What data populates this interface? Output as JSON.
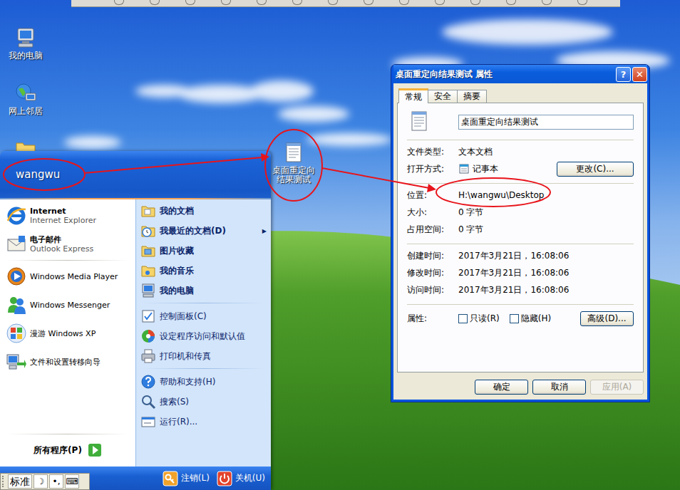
{
  "desktop": {
    "icons": [
      {
        "label": "我的电脑"
      },
      {
        "label": "网上邻居"
      }
    ],
    "file": {
      "label": "桌面重定向结果测试"
    }
  },
  "start_menu": {
    "user": "wangwu",
    "pinned": [
      {
        "title": "Internet",
        "subtitle": "Internet Explorer"
      },
      {
        "title": "电子邮件",
        "subtitle": "Outlook Express"
      }
    ],
    "recent": [
      {
        "label": "Windows Media Player"
      },
      {
        "label": "Windows Messenger"
      },
      {
        "label": "漫游 Windows XP"
      },
      {
        "label": "文件和设置转移向导"
      }
    ],
    "all_programs": "所有程序(P)",
    "submenu_arrow": "▶",
    "places": [
      {
        "bold": true,
        "items": [
          {
            "label": "我的文档",
            "submenu": false
          },
          {
            "label": "我最近的文档(D)",
            "submenu": true
          },
          {
            "label": "图片收藏",
            "submenu": false
          },
          {
            "label": "我的音乐",
            "submenu": false
          },
          {
            "label": "我的电脑",
            "submenu": false
          }
        ]
      },
      {
        "bold": false,
        "items": [
          {
            "label": "控制面板(C)",
            "submenu": false
          },
          {
            "label": "设定程序访问和默认值",
            "submenu": false
          },
          {
            "label": "打印机和传真",
            "submenu": false
          }
        ]
      },
      {
        "bold": false,
        "items": [
          {
            "label": "帮助和支持(H)",
            "submenu": false
          },
          {
            "label": "搜索(S)",
            "submenu": false
          },
          {
            "label": "运行(R)...",
            "submenu": false
          }
        ]
      }
    ],
    "logoff": "注销(L)",
    "shutdown": "关机(U)"
  },
  "ime_bar": {
    "mode": "标准",
    "buttons": [
      "☽",
      "•,",
      "⌨"
    ]
  },
  "dialog": {
    "title": "桌面重定向结果测试 属性",
    "help": "?",
    "close": "✕",
    "tabs": [
      {
        "label": "常规",
        "selected": true
      },
      {
        "label": "安全",
        "selected": false
      },
      {
        "label": "摘要",
        "selected": false
      }
    ],
    "name": "桌面重定向结果测试",
    "sections": [
      [
        {
          "kind": "text",
          "label": "文件类型:",
          "value": "文本文档"
        },
        {
          "kind": "app",
          "label": "打开方式:",
          "value": "记事本",
          "button": "更改(C)..."
        }
      ],
      [
        {
          "kind": "text",
          "label": "位置:",
          "value": "H:\\wangwu\\Desktop"
        },
        {
          "kind": "text",
          "label": "大小:",
          "value": "0 字节"
        },
        {
          "kind": "text",
          "label": "占用空间:",
          "value": "0 字节"
        }
      ],
      [
        {
          "kind": "text",
          "label": "创建时间:",
          "value": "2017年3月21日，16:08:06"
        },
        {
          "kind": "text",
          "label": "修改时间:",
          "value": "2017年3月21日，16:08:06"
        },
        {
          "kind": "text",
          "label": "访问时间:",
          "value": "2017年3月21日，16:08:06"
        }
      ]
    ],
    "attributes": {
      "label": "属性:",
      "checkboxes": [
        {
          "label": "只读(R)",
          "checked": false
        },
        {
          "label": "隐藏(H)",
          "checked": false
        }
      ],
      "button": "高级(D)..."
    },
    "buttons": [
      {
        "label": "确定",
        "disabled": false
      },
      {
        "label": "取消",
        "disabled": false
      },
      {
        "label": "应用(A)",
        "disabled": true
      }
    ]
  }
}
